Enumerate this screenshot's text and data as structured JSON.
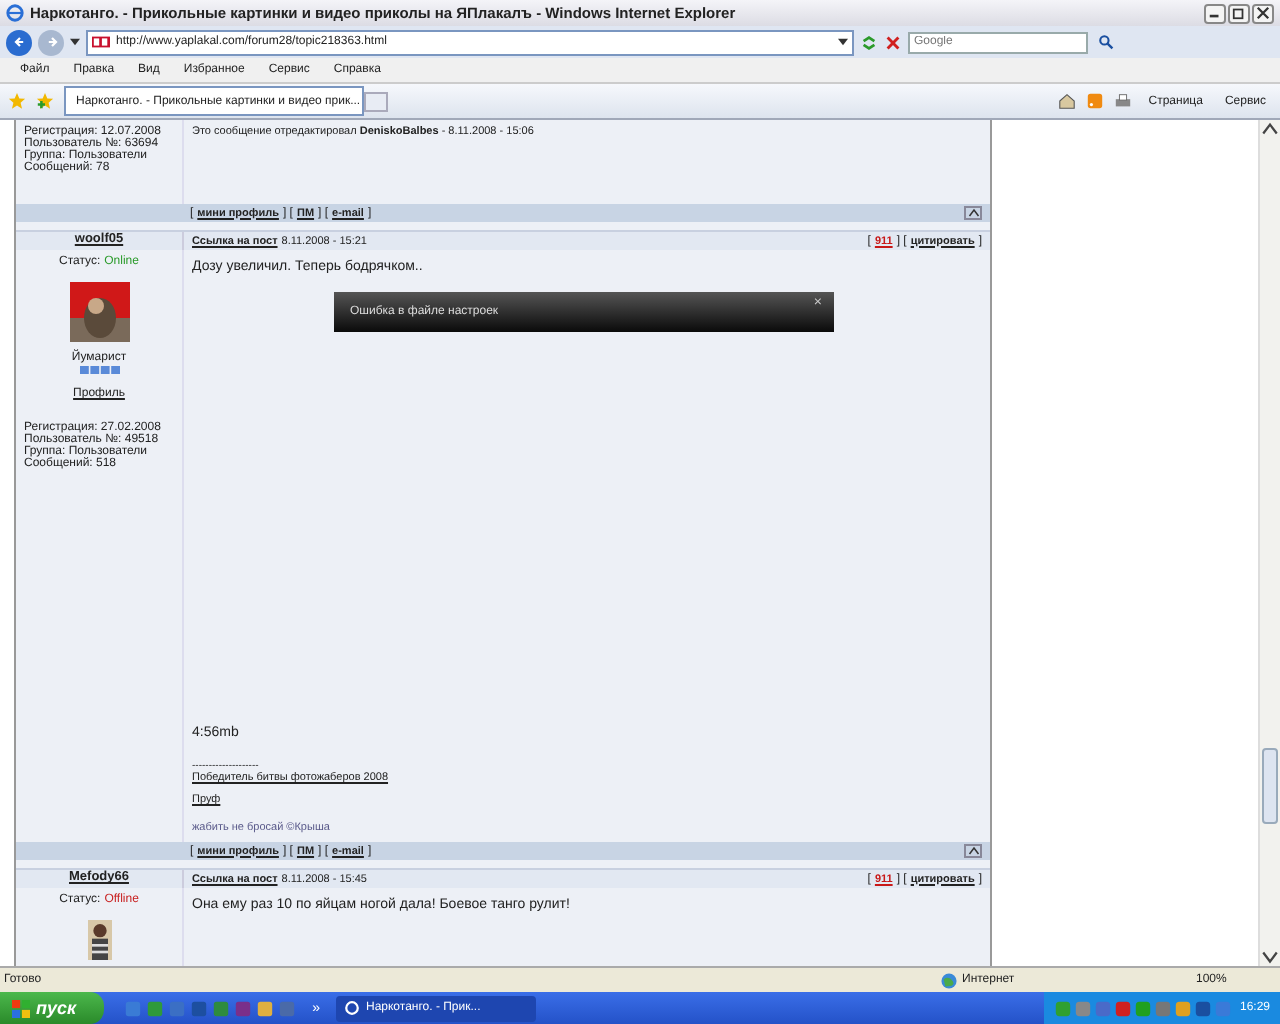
{
  "window": {
    "title": "Наркотанго. - Прикольные картинки и видео приколы на ЯПлакалъ - Windows Internet Explorer"
  },
  "address": {
    "url": "http://www.yaplakal.com/forum28/topic218363.html",
    "search_placeholder": "Google"
  },
  "menu": [
    "Файл",
    "Правка",
    "Вид",
    "Избранное",
    "Сервис",
    "Справка"
  ],
  "tabs": [
    {
      "label": "Наркотанго. - Прикольные картинки и видео прик...",
      "selected": true
    }
  ],
  "toolbar": [
    "Страница",
    "Сервис"
  ],
  "posts": [
    {
      "profile": [
        "Регистрация: 12.07.2008",
        "Пользователь №: 63694",
        "Группа: Пользователи",
        "Сообщений: 78"
      ],
      "body_top": [
        {
          "kind": "note",
          "text": "Это сообщение отредактировал **DeniskoBalbes** - 8.11.2008 - 15:06"
        }
      ],
      "footer": [
        {
          "kind": "sep",
          "text": "["
        },
        {
          "kind": "link",
          "text": "мини профиль"
        },
        {
          "kind": "sep",
          "text": "] ["
        },
        {
          "kind": "link",
          "text": "ПМ"
        },
        {
          "kind": "sep",
          "text": "] ["
        },
        {
          "kind": "link",
          "text": "e-mail"
        },
        {
          "kind": "sep",
          "text": "]"
        }
      ]
    },
    {
      "author": "woolf05",
      "status_label": "Статус:",
      "status": "Online",
      "online": true,
      "permalink": "Ссылка на пост",
      "date": "8.11.2008 - 15:21",
      "actions": [
        {
          "kind": "sep",
          "text": "["
        },
        {
          "kind": "red",
          "text": "911"
        },
        {
          "kind": "sep",
          "text": "] ["
        },
        {
          "kind": "link",
          "text": "цитировать"
        },
        {
          "kind": "sep",
          "text": "]"
        }
      ],
      "avatar": {
        "kind": "picture"
      },
      "rank": "Йумарист",
      "profile_link": "Профиль",
      "profile": [
        "Регистрация: 27.02.2008",
        "Пользователь №: 49518",
        "Группа: Пользователи",
        "Сообщений: 518"
      ],
      "body_top": [
        {
          "kind": "text",
          "text": "Дозу увеличил. Теперь бодрячком.."
        }
      ],
      "body_bottom": [
        {
          "kind": "big",
          "text": "4:56mb"
        },
        {
          "kind": "small",
          "text": "--------------------"
        },
        {
          "kind": "link",
          "text": "Победитель битвы фотожаберов 2008"
        },
        {
          "kind": "link",
          "text": "Пруф"
        },
        {
          "kind": "sig",
          "text": "жабить не бросай ©Крыша"
        }
      ],
      "footer": [
        {
          "kind": "sep",
          "text": "["
        },
        {
          "kind": "link",
          "text": "мини профиль"
        },
        {
          "kind": "sep",
          "text": "] ["
        },
        {
          "kind": "link",
          "text": "ПМ"
        },
        {
          "kind": "sep",
          "text": "] ["
        },
        {
          "kind": "link",
          "text": "e-mail"
        },
        {
          "kind": "sep",
          "text": "]"
        }
      ]
    },
    {
      "author": "Mefody66",
      "status_label": "Статус:",
      "status": "Offline",
      "online": false,
      "permalink": "Ссылка на пост",
      "date": "8.11.2008 - 15:45",
      "actions": [
        {
          "kind": "sep",
          "text": "["
        },
        {
          "kind": "red",
          "text": "911"
        },
        {
          "kind": "sep",
          "text": "] ["
        },
        {
          "kind": "link",
          "text": "цитировать"
        },
        {
          "kind": "sep",
          "text": "]"
        }
      ],
      "avatar": {
        "kind": "picture"
      },
      "body_top": [
        {
          "kind": "text",
          "text": "Она ему раз 10 по яйцам ногой дала! Боевое танго рулит!"
        }
      ]
    }
  ],
  "toast": {
    "message": "Ошибка в файле настроек",
    "close": "×"
  },
  "status_bar": {
    "text": "Готово",
    "zone": "Интернет",
    "zoom": "100%"
  },
  "taskbar": {
    "start": "пуск",
    "more": "»",
    "task": "Наркотанго. - Прик...",
    "clock": "16:29"
  }
}
